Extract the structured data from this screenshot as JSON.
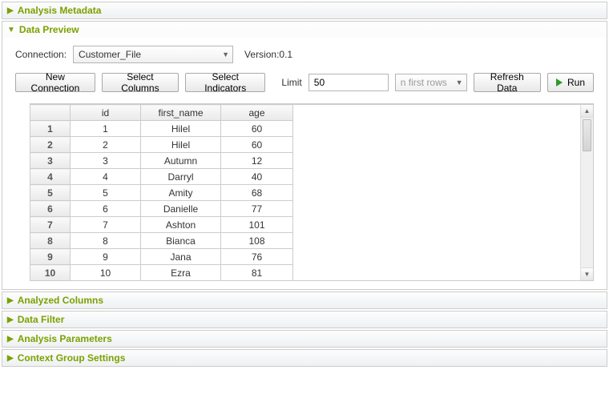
{
  "sections": {
    "analysis_metadata": "Analysis Metadata",
    "data_preview": "Data Preview",
    "analyzed_columns": "Analyzed Columns",
    "data_filter": "Data Filter",
    "analysis_parameters": "Analysis Parameters",
    "context_group_settings": "Context Group Settings"
  },
  "connection": {
    "label": "Connection:",
    "value": "Customer_File",
    "version": "Version:0.1"
  },
  "toolbar": {
    "new_connection": "New Connection",
    "select_columns": "Select Columns",
    "select_indicators": "Select Indicators",
    "limit_label": "Limit",
    "limit_value": "50",
    "row_mode": "n first rows",
    "refresh": "Refresh Data",
    "run": "Run"
  },
  "table": {
    "headers": {
      "id": "id",
      "first_name": "first_name",
      "age": "age"
    },
    "rows": [
      {
        "n": "1",
        "id": "1",
        "first_name": "Hilel",
        "age": "60"
      },
      {
        "n": "2",
        "id": "2",
        "first_name": "Hilel",
        "age": "60"
      },
      {
        "n": "3",
        "id": "3",
        "first_name": "Autumn",
        "age": "12"
      },
      {
        "n": "4",
        "id": "4",
        "first_name": "Darryl",
        "age": "40"
      },
      {
        "n": "5",
        "id": "5",
        "first_name": "Amity",
        "age": "68"
      },
      {
        "n": "6",
        "id": "6",
        "first_name": "Danielle",
        "age": "77"
      },
      {
        "n": "7",
        "id": "7",
        "first_name": "Ashton",
        "age": "101"
      },
      {
        "n": "8",
        "id": "8",
        "first_name": "Bianca",
        "age": "108"
      },
      {
        "n": "9",
        "id": "9",
        "first_name": "Jana",
        "age": "76"
      },
      {
        "n": "10",
        "id": "10",
        "first_name": "Ezra",
        "age": "81"
      }
    ]
  }
}
